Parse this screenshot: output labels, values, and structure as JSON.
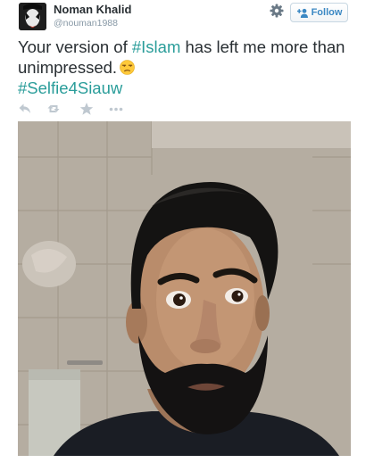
{
  "user": {
    "display_name": "Noman Khalid",
    "screen_name": "@nouman1988"
  },
  "follow_button": {
    "label": "Follow",
    "icon": "add-user-icon"
  },
  "settings_icon": "gear-icon",
  "tweet": {
    "text_part1": "Your version of ",
    "hashtag1": "#Islam",
    "text_part2": " has left me more than unimpressed.",
    "emoji": "unamused-face-emoji",
    "hashtag2": "#Selfie4Siauw"
  },
  "actions": [
    {
      "name": "reply",
      "icon": "reply-icon"
    },
    {
      "name": "retweet",
      "icon": "retweet-icon"
    },
    {
      "name": "favorite",
      "icon": "star-icon"
    },
    {
      "name": "more",
      "icon": "more-icon"
    }
  ],
  "photo": {
    "subject": "bearded-man-selfie"
  },
  "colors": {
    "text": "#292f33",
    "muted": "#8899a6",
    "hashtag": "#2a9d9a",
    "follow": "#3b88c3",
    "icon": "#bfc8d0"
  }
}
